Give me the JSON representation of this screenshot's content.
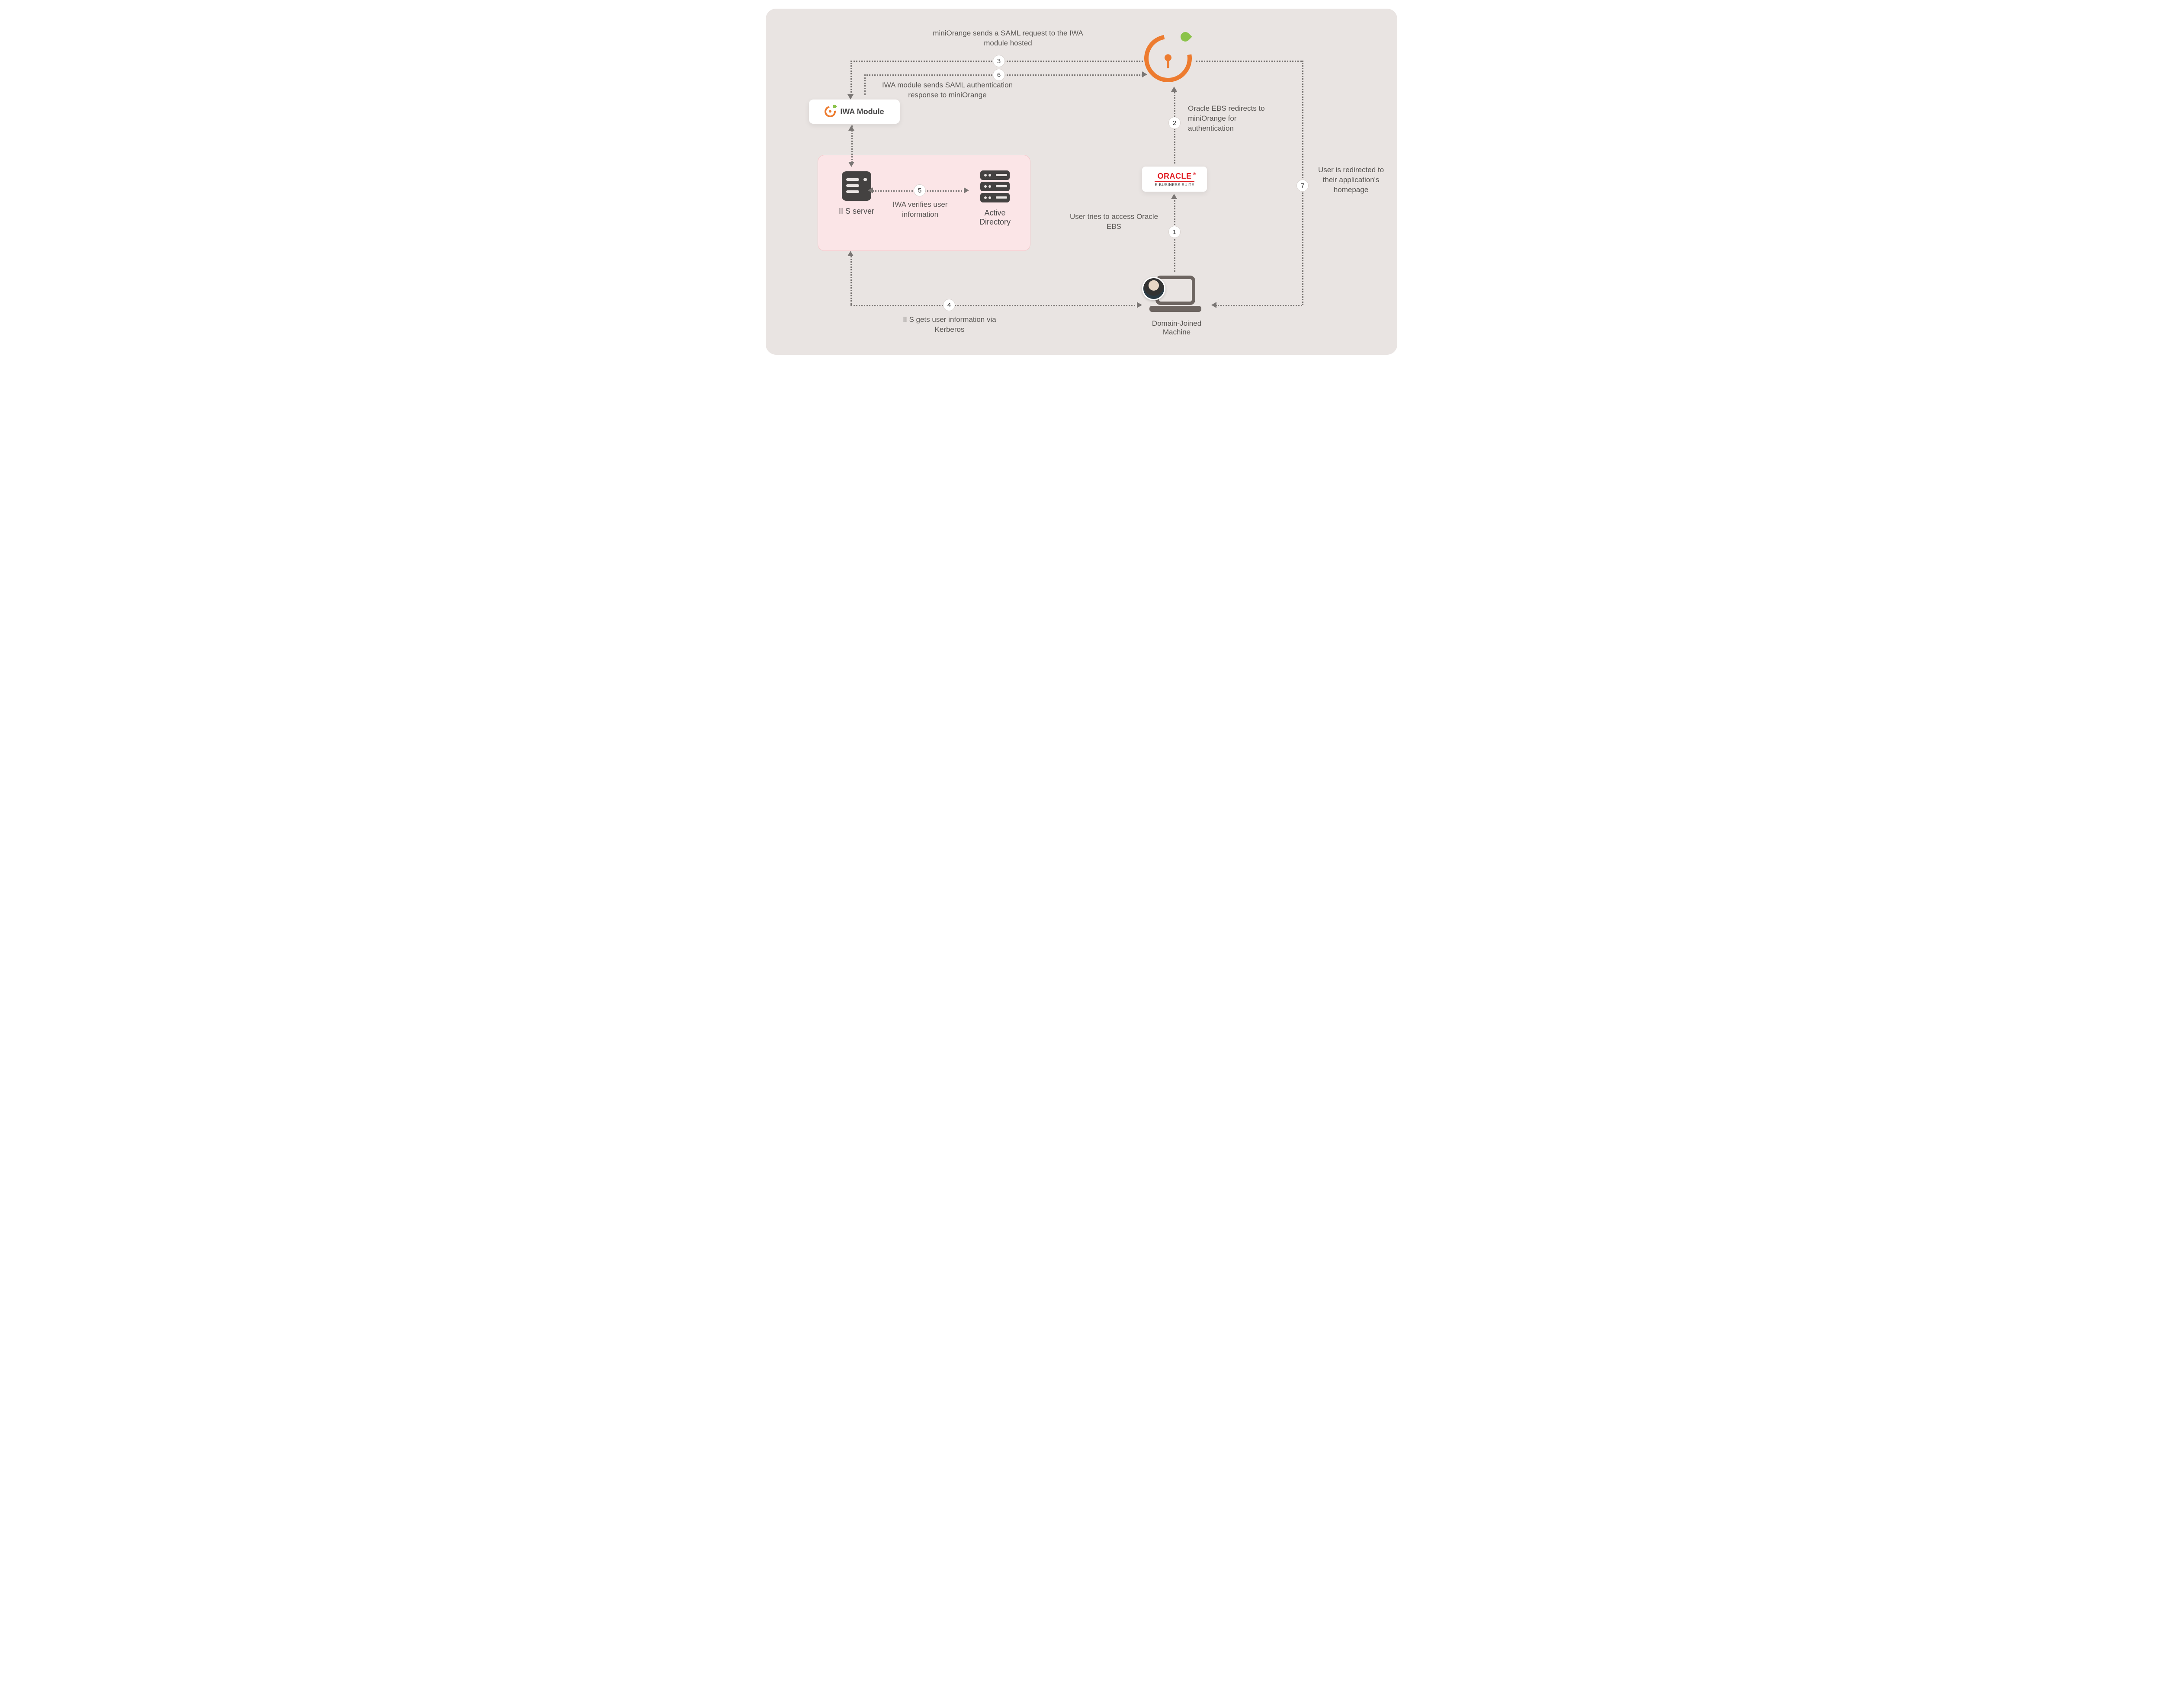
{
  "steps": {
    "s1": {
      "num": "1",
      "text": "User tries to access Oracle  EBS"
    },
    "s2": {
      "num": "2",
      "text": "Oracle EBS redirects to miniOrange for authentication"
    },
    "s3": {
      "num": "3",
      "text": "miniOrange sends a SAML request to the IWA module hosted"
    },
    "s4": {
      "num": "4",
      "text": "II S gets user information via Kerberos"
    },
    "s5": {
      "num": "5",
      "text": "IWA verifies user information"
    },
    "s6": {
      "num": "6",
      "text": "IWA module sends SAML authentication response to miniOrange"
    },
    "s7": {
      "num": "7",
      "text": "User is redirected to their application's homepage"
    }
  },
  "nodes": {
    "iwa_module": "IWA Module",
    "iis_server": "II S server",
    "active_directory": "Active Directory",
    "oracle_brand": "ORACLE",
    "oracle_sub": "E-BUSINESS SUITE",
    "domain_machine": "Domain-Joined Machine"
  },
  "colors": {
    "bg": "#e9e4e2",
    "pink": "#fbe5e7",
    "accent": "#ed7b2f",
    "leaf": "#8bc34a",
    "oracle": "#e11b22",
    "line": "#7a7674",
    "text": "#595653"
  }
}
